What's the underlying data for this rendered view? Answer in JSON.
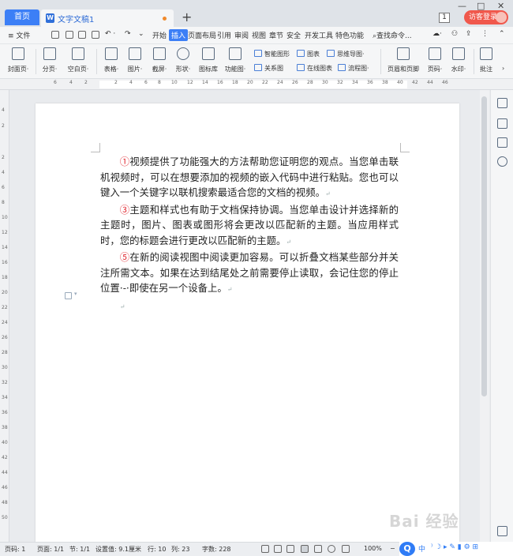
{
  "titlebar": {
    "home_tab": "首页",
    "doc_tab": "文字文稿1",
    "new_tab": "+",
    "badge": "1",
    "login": "访客登录",
    "window_controls": [
      "—",
      "□",
      "✕"
    ]
  },
  "menu": {
    "file": "≡ 文件",
    "items": [
      "开始",
      "插入",
      "页面布局",
      "引用",
      "审阅",
      "视图",
      "章节",
      "安全",
      "开发工具",
      "特色功能"
    ],
    "active": "插入",
    "search": "查找命令..."
  },
  "ribbon": {
    "big": [
      {
        "label": "封面页·"
      },
      {
        "label": "分页·"
      },
      {
        "label": "空白页·"
      },
      {
        "label": "表格·"
      },
      {
        "label": "图片·"
      },
      {
        "label": "截屏·"
      },
      {
        "label": "形状·"
      },
      {
        "label": "图标库"
      },
      {
        "label": "功能图·"
      },
      {
        "label": "页眉和页脚"
      },
      {
        "label": "页码·"
      },
      {
        "label": "水印·"
      },
      {
        "label": "批注"
      }
    ],
    "small": [
      "智能图形",
      "图表",
      "思维导图·",
      "关系图",
      "在线图表",
      "流程图·"
    ]
  },
  "ruler": {
    "top_numbers": [
      "6",
      "4",
      "2",
      "2",
      "4",
      "6",
      "8",
      "10",
      "12",
      "14",
      "16",
      "18",
      "20",
      "22",
      "24",
      "26",
      "28",
      "30",
      "32",
      "34",
      "36",
      "38",
      "40",
      "42",
      "44",
      "46"
    ],
    "left_numbers": [
      "4",
      "2",
      "2",
      "4",
      "6",
      "8",
      "10",
      "12",
      "14",
      "16",
      "18",
      "20",
      "22",
      "24",
      "26",
      "28",
      "30",
      "32",
      "34",
      "36",
      "38",
      "40",
      "42",
      "44",
      "46",
      "48",
      "50"
    ]
  },
  "document": {
    "paragraphs": [
      {
        "num": "①",
        "text": "视频提供了功能强大的方法帮助您证明您的观点。当您单击联机视频时，可以在想要添加的视频的嵌入代码中进行粘贴。您也可以键入一个关键字以联机搜索最适合您的文档的视频。"
      },
      {
        "num": "③",
        "text": "主题和样式也有助于文档保持协调。当您单击设计并选择新的主题时，图片、图表或图形将会更改以匹配新的主题。当应用样式时，您的标题会进行更改以匹配新的主题。"
      },
      {
        "num": "⑤",
        "text": "在新的阅读视图中阅读更加容易。可以折叠文档某些部分并关注所需文本。如果在达到结尾处之前需要停止读取，会记住您的停止位置·-·即使在另一个设备上。"
      }
    ],
    "para_mark": "↵"
  },
  "status": {
    "page": "页码: 1",
    "pages": "页面: 1/1",
    "section": "节: 1/1",
    "setting": "设置值: 9.1厘米",
    "row": "行: 10",
    "col": "列: 23",
    "words": "字数: 228",
    "zoom": "100%",
    "minus": "−"
  },
  "ime": {
    "logo": "Q",
    "lang": "中",
    "icons": "⁾ ☽ ▸ ✎ ▮ ⚙ ⊞"
  },
  "watermark": "Bai 经验"
}
